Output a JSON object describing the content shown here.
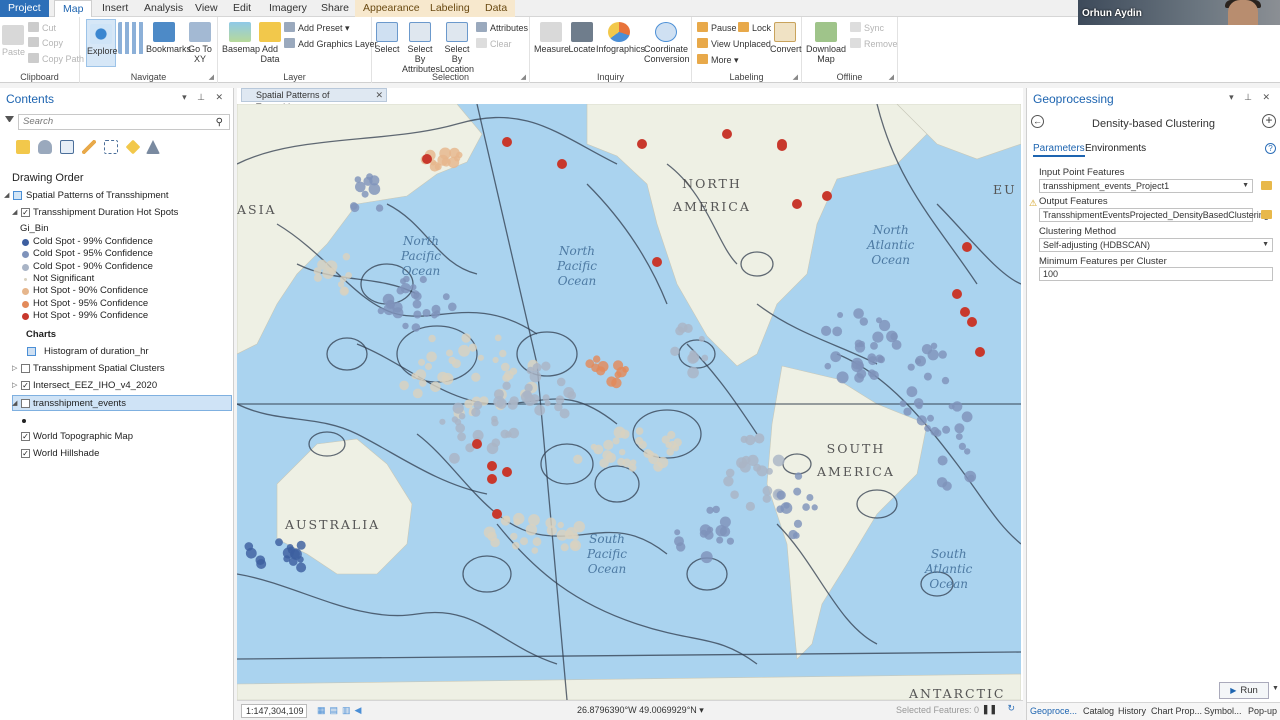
{
  "tabs": [
    "Project",
    "Map",
    "Insert",
    "Analysis",
    "View",
    "Edit",
    "Imagery",
    "Share",
    "Appearance",
    "Labeling",
    "Data"
  ],
  "ribbon": {
    "clipboard": {
      "paste": "Paste",
      "cut": "Cut",
      "copy": "Copy",
      "copy_path": "Copy Path",
      "label": "Clipboard"
    },
    "navigate": {
      "explore": "Explore",
      "bookmarks": "Bookmarks",
      "goto": "Go To XY",
      "label": "Navigate"
    },
    "layer": {
      "basemap": "Basemap",
      "add_data": "Add Data",
      "add_preset": "Add Preset",
      "add_graphics": "Add Graphics Layer",
      "label": "Layer"
    },
    "selection": {
      "select": "Select",
      "by_attributes": "Select By Attributes",
      "by_location": "Select By Location",
      "attributes": "Attributes",
      "clear": "Clear",
      "label": "Selection"
    },
    "inquiry": {
      "measure": "Measure",
      "locate": "Locate",
      "infographics": "Infographics",
      "coord_conv": "Coordinate Conversion",
      "label": "Inquiry"
    },
    "labeling": {
      "pause": "Pause",
      "lock": "Lock",
      "view_unplaced": "View Unplaced",
      "more": "More",
      "convert": "Convert",
      "label": "Labeling"
    },
    "offline": {
      "download": "Download Map",
      "sync": "Sync",
      "remove": "Remove",
      "label": "Offline"
    }
  },
  "contents": {
    "title": "Contents",
    "search_placeholder": "Search",
    "drawing_order": "Drawing Order",
    "map_name": "Spatial Patterns of Transshipment",
    "layers": {
      "hotspots": "Transshipment Duration Hot Spots",
      "gi_bin": "Gi_Bin",
      "legend": [
        {
          "label": "Cold Spot - 99% Confidence",
          "color": "#3d5fa0"
        },
        {
          "label": "Cold Spot - 95% Confidence",
          "color": "#7f93bb"
        },
        {
          "label": "Cold Spot - 90% Confidence",
          "color": "#a9b4c6"
        },
        {
          "label": "Not Significant",
          "color": "#d9d2c0"
        },
        {
          "label": "Hot Spot - 90% Confidence",
          "color": "#e6b68c"
        },
        {
          "label": "Hot Spot - 95% Confidence",
          "color": "#e38a5a"
        },
        {
          "label": "Hot Spot - 99% Confidence",
          "color": "#c8382c"
        }
      ],
      "charts": "Charts",
      "histogram": "Histogram of duration_hr",
      "clusters": "Transshipment Spatial Clusters",
      "intersect": "Intersect_EEZ_IHO_v4_2020",
      "events": "transshipment_events",
      "topo": "World Topographic Map",
      "hillshade": "World Hillshade"
    }
  },
  "map": {
    "tab_title": "Spatial Patterns of Transshipment",
    "labels": {
      "asia": "ASIA",
      "north_america": "NORTH\nAMERICA",
      "south_america": "SOUTH\nAMERICA",
      "australia": "AUSTRALIA",
      "europe": "EU",
      "antarctica": "ANTARCTIC",
      "npo_left": "North\nPacific\nOcean",
      "npo_right": "North\nPacific\nOcean",
      "nao": "North\nAtlantic\nOcean",
      "spo": "South\nPacific\nOcean",
      "sao": "South\nAtlantic\nOcean"
    },
    "scale": "1:147,304,109",
    "coords": "26.8796390°W 49.0069929°N",
    "selected_features": "Selected Features: 0"
  },
  "geoprocessing": {
    "title": "Geoprocessing",
    "tool": "Density-based Clustering",
    "tab_parameters": "Parameters",
    "tab_environments": "Environments",
    "input_label": "Input Point Features",
    "input_value": "transshipment_events_Project1",
    "output_label": "Output Features",
    "output_value": "TransshipmentEventsProjected_DensityBasedClustering",
    "method_label": "Clustering Method",
    "method_value": "Self-adjusting (HDBSCAN)",
    "min_label": "Minimum Features per Cluster",
    "min_value": "100",
    "run": "Run",
    "bottom_tabs": [
      "Geoproce...",
      "Catalog",
      "History",
      "Chart Prop...",
      "Symbol...",
      "Pop-up"
    ]
  },
  "webcam": {
    "name": "Orhun Aydin"
  },
  "colors": {
    "accent": "#1d64b0",
    "project_tab": "#2d6fb8",
    "ocean": "#a9d2ee",
    "land": "#eef0e4"
  }
}
